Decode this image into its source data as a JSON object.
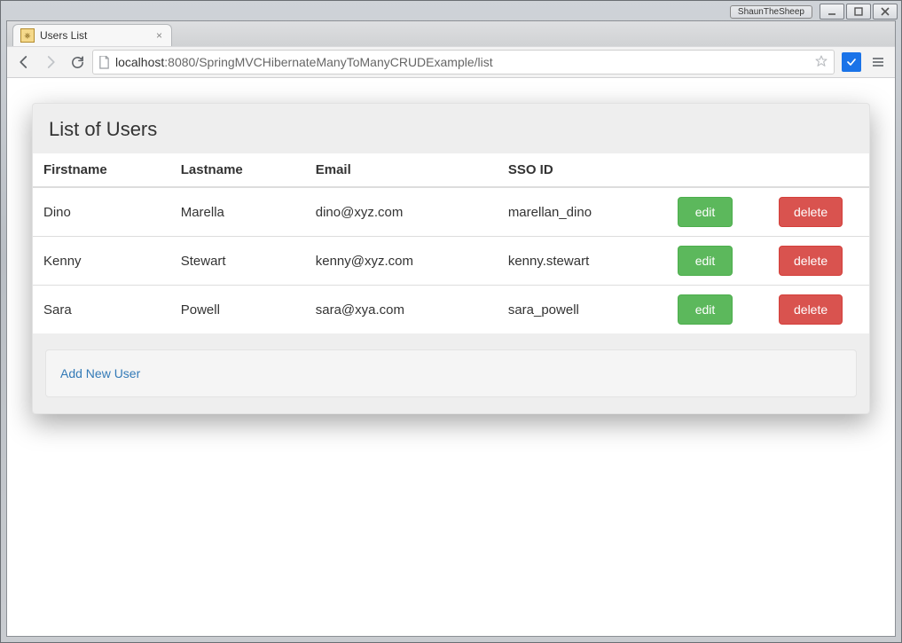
{
  "os": {
    "app_pill": "ShaunTheSheep"
  },
  "browser": {
    "tab_title": "Users List",
    "url_host": "localhost",
    "url_port_path": ":8080/SpringMVCHibernateManyToManyCRUDExample/list"
  },
  "page": {
    "heading": "List of Users",
    "columns": {
      "firstname": "Firstname",
      "lastname": "Lastname",
      "email": "Email",
      "sso_id": "SSO ID",
      "edit": "",
      "delete": ""
    },
    "labels": {
      "edit": "edit",
      "delete": "delete",
      "add_new_user": "Add New User"
    },
    "rows": [
      {
        "firstname": "Dino",
        "lastname": "Marella",
        "email": "dino@xyz.com",
        "sso_id": "marellan_dino"
      },
      {
        "firstname": "Kenny",
        "lastname": "Stewart",
        "email": "kenny@xyz.com",
        "sso_id": "kenny.stewart"
      },
      {
        "firstname": "Sara",
        "lastname": "Powell",
        "email": "sara@xya.com",
        "sso_id": "sara_powell"
      }
    ]
  }
}
